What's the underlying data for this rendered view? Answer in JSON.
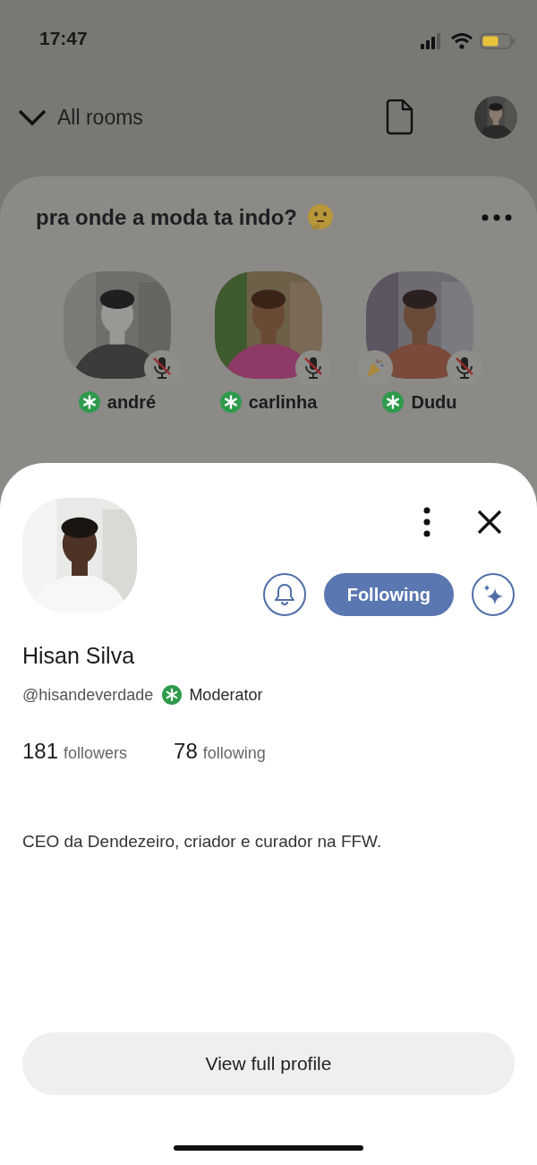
{
  "status_bar": {
    "time": "17:47"
  },
  "header": {
    "rooms_label": "All rooms"
  },
  "room": {
    "title": "pra onde a moda ta indo?",
    "speakers": [
      {
        "name": "andré",
        "moderator": true,
        "muted": true,
        "new_user": false
      },
      {
        "name": "carlinha",
        "moderator": true,
        "muted": true,
        "new_user": false
      },
      {
        "name": "Dudu",
        "moderator": true,
        "muted": true,
        "new_user": true
      }
    ]
  },
  "profile": {
    "name": "Hisan Silva",
    "handle": "@hisandeverdade",
    "role": "Moderator",
    "moderator": true,
    "followers_count": "181",
    "followers_label": "followers",
    "following_count": "78",
    "following_label": "following",
    "follow_button": {
      "label": "Following",
      "following": true
    },
    "bio": "CEO da Dendezeiro, criador e curador na FFW.",
    "view_profile": "View full profile"
  }
}
